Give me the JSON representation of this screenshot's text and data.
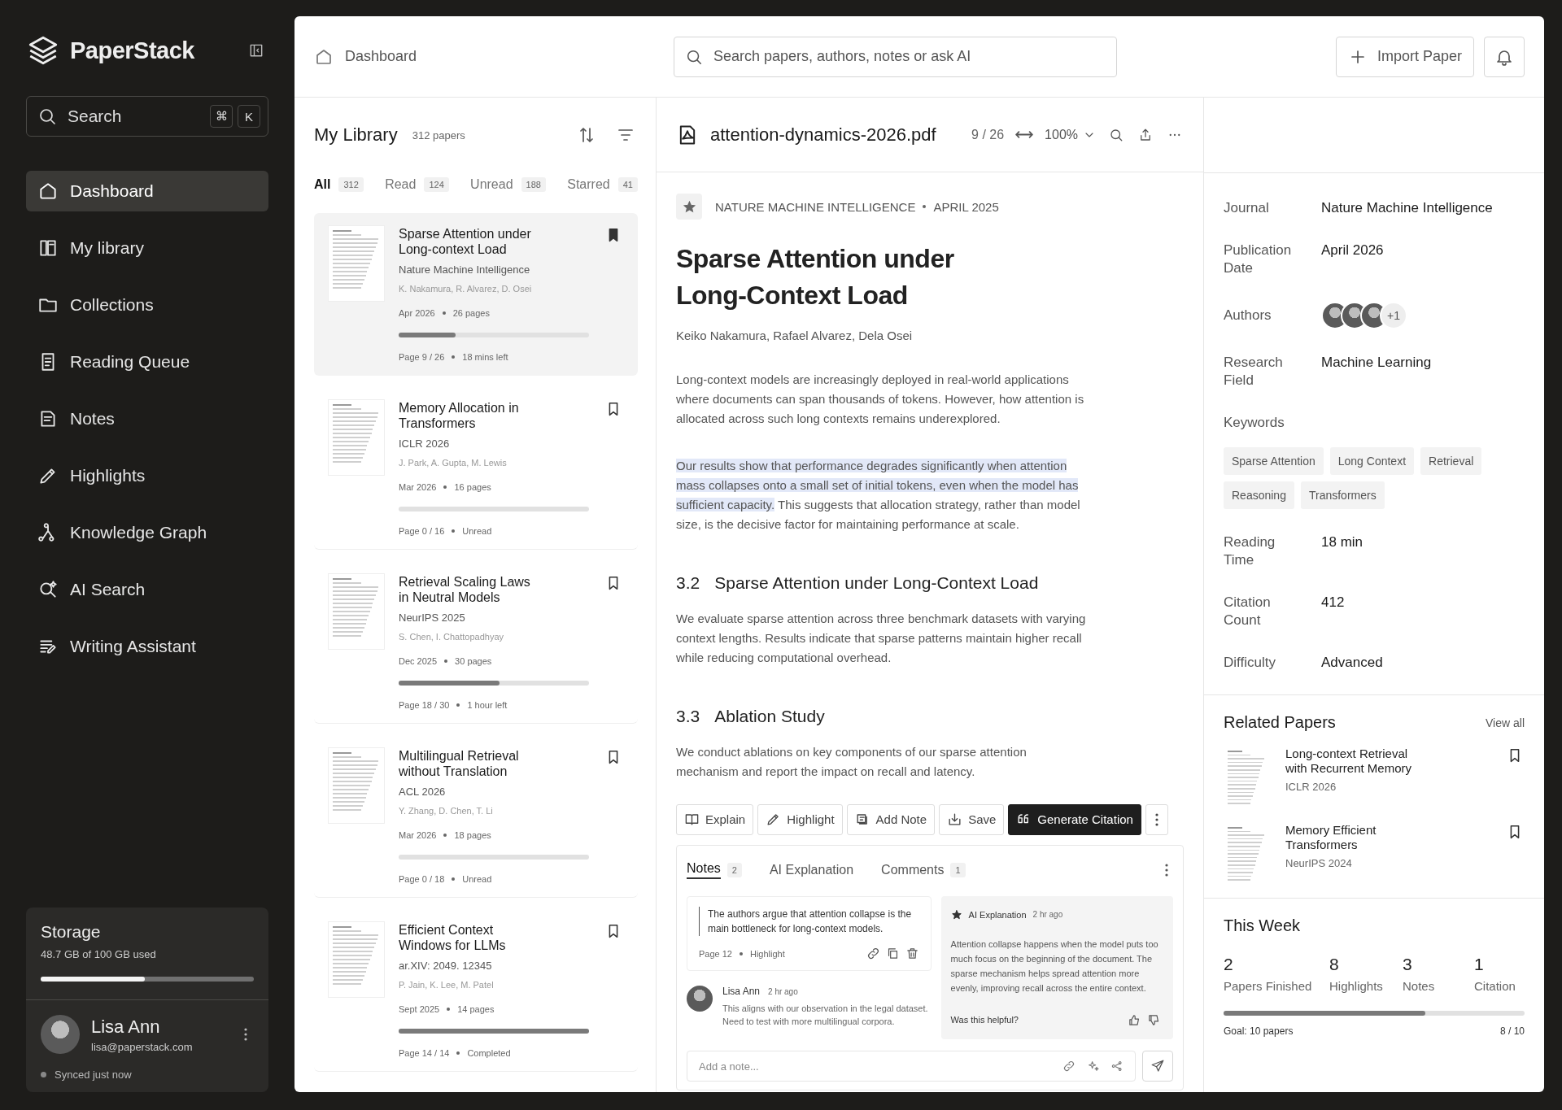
{
  "sidebar": {
    "brand": "PaperStack",
    "search": {
      "placeholder": "Search",
      "shortcut": [
        "⌘",
        "K"
      ]
    },
    "items": [
      {
        "label": "Dashboard",
        "selected": true
      },
      {
        "label": "My library",
        "selected": false
      },
      {
        "label": "Collections",
        "selected": false
      },
      {
        "label": "Reading Queue",
        "selected": false
      },
      {
        "label": "Notes",
        "selected": false
      },
      {
        "label": "Highlights",
        "selected": false
      },
      {
        "label": "Knowledge Graph",
        "selected": false
      },
      {
        "label": "AI Search",
        "selected": false
      },
      {
        "label": "Writing Assistant",
        "selected": false
      }
    ],
    "storage": {
      "title": "Storage",
      "usage": "48.7 GB of 100 GB used",
      "level": 0.487
    },
    "user": {
      "name": "Lisa Ann",
      "email": "lisa@paperstack.com",
      "sync": "Synced just now"
    }
  },
  "header": {
    "breadcrumb": "Dashboard",
    "search": {
      "placeholder": "Search papers, authors, notes or ask AI"
    },
    "import_button": "Import Paper"
  },
  "library": {
    "title": "My Library",
    "count": "312 papers",
    "tabs": [
      {
        "label": "All",
        "count": "312",
        "selected": true
      },
      {
        "label": "Read",
        "count": "124",
        "selected": false
      },
      {
        "label": "Unread",
        "count": "188",
        "selected": false
      },
      {
        "label": "Starred",
        "count": "41",
        "selected": false
      }
    ],
    "papers": [
      {
        "title": "Sparse Attention under Long-context Load",
        "venue": "Nature Machine Intelligence",
        "authors": "K. Nakamura, R. Alvarez, D. Osei",
        "date": "Apr 2026",
        "pages": "26 pages",
        "level": 0.3,
        "progress": "Page 9 / 26",
        "status": "18 mins left",
        "bookmarked": true,
        "selected": true
      },
      {
        "title": "Memory Allocation in Transformers",
        "venue": "ICLR 2026",
        "authors": "J. Park, A. Gupta, M. Lewis",
        "date": "Mar 2026",
        "pages": "16 pages",
        "level": 0,
        "progress": "Page 0 / 16",
        "status": "Unread",
        "bookmarked": false,
        "selected": false
      },
      {
        "title": "Retrieval Scaling Laws in Neutral Models",
        "venue": "NeurIPS 2025",
        "authors": "S. Chen, I. Chattopadhyay",
        "date": "Dec 2025",
        "pages": "30 pages",
        "level": 0.53,
        "progress": "Page 18 / 30",
        "status": "1 hour left",
        "bookmarked": false,
        "selected": false
      },
      {
        "title": "Multilingual Retrieval without Translation",
        "venue": "ACL 2026",
        "authors": "Y. Zhang, D. Chen, T. Li",
        "date": "Mar 2026",
        "pages": "18 pages",
        "level": 0,
        "progress": "Page 0 / 18",
        "status": "Unread",
        "bookmarked": false,
        "selected": false
      },
      {
        "title": "Efficient Context Windows for LLMs",
        "venue": "ar.XIV: 2049. 12345",
        "authors": "P. Jain, K. Lee, M. Patel",
        "date": "Sept 2025",
        "pages": "14 pages",
        "level": 1,
        "progress": "Page 14 / 14",
        "status": "Completed",
        "bookmarked": false,
        "selected": false
      }
    ]
  },
  "reader": {
    "file": "attention-dynamics-2026.pdf",
    "page": "9 / 26",
    "zoom": "100%",
    "starred": true,
    "journal": "NATURE MACHINE INTELLIGENCE",
    "date": "APRIL 2025",
    "title": "Sparse Attention under Long-Context Load",
    "authors": "Keiko Nakamura, Rafael Alvarez, Dela Osei",
    "abstract": "Long-context models are increasingly deployed in real-world applications where documents can span thousands of tokens. However, how attention is allocated across such long contexts remains underexplored.",
    "finding": {
      "highlight": "Our results show that performance degrades significantly when attention mass collapses onto a small set of initial tokens, even when the model has sufficient capacity.",
      "text": " This suggests that allocation strategy, rather than model size, is the decisive factor for maintaining performance at scale."
    },
    "sections": [
      {
        "number": "3.2",
        "heading": "Sparse Attention under Long-Context Load",
        "text": "We evaluate sparse attention across three benchmark datasets with varying context lengths. Results indicate that sparse patterns maintain higher recall while reducing computational overhead."
      },
      {
        "number": "3.3",
        "heading": "Ablation Study",
        "text": "We conduct ablations on key components of our sparse attention mechanism and report the impact on recall and latency."
      }
    ],
    "actions": [
      {
        "label": "Explain",
        "kind": "book",
        "primary": false
      },
      {
        "label": "Highlight",
        "kind": "pen",
        "primary": false
      },
      {
        "label": "Add Note",
        "kind": "note",
        "primary": false
      },
      {
        "label": "Save",
        "kind": "save",
        "primary": false
      },
      {
        "label": "Generate Citation",
        "kind": "quote",
        "primary": true
      }
    ],
    "notes_panel": {
      "tabs": [
        {
          "label": "Notes",
          "count": "2",
          "selected": true
        },
        {
          "label": "AI Explanation",
          "selected": false
        },
        {
          "label": "Comments",
          "count": "1",
          "selected": false
        }
      ],
      "note": {
        "text": "The authors argue that attention collapse is the main bottleneck for long-context models.",
        "page": "Page 12",
        "type": "Highlight"
      },
      "comment": {
        "author": "Lisa Ann",
        "time": "2 hr ago",
        "text": "This aligns with our observation in the legal dataset. Need to test with more multilingual corpora."
      },
      "ai": {
        "title": "AI Explanation",
        "time": "2 hr ago",
        "text": "Attention collapse happens when the model puts too much focus on the beginning of the document. The sparse mechanism helps spread attention more evenly, improving recall across the entire context.",
        "feedback": "Was this helpful?"
      },
      "input": {
        "placeholder": "Add a note..."
      }
    }
  },
  "details": {
    "fields": [
      {
        "label": "Journal",
        "value": "Nature Machine Intelligence"
      },
      {
        "label": "Publication Date",
        "value": "April 2026"
      }
    ],
    "authors": {
      "label": "Authors",
      "more": "+1"
    },
    "fields2": [
      {
        "label": "Research Field",
        "value": "Machine Learning"
      }
    ],
    "keywords": {
      "label": "Keywords",
      "items": [
        "Sparse Attention",
        "Long Context",
        "Retrieval",
        "Reasoning",
        "Transformers"
      ]
    },
    "fields3": [
      {
        "label": "Reading Time",
        "value": "18 min"
      },
      {
        "label": "Citation Count",
        "value": "412"
      },
      {
        "label": "Difficulty",
        "value": "Advanced"
      }
    ]
  },
  "related": {
    "title": "Related Papers",
    "view_all": "View all",
    "papers": [
      {
        "title": "Long-context Retrieval with Recurrent Memory",
        "venue": "ICLR 2026"
      },
      {
        "title": "Memory Efficient Transformers",
        "venue": "NeurIPS 2024"
      }
    ]
  },
  "week": {
    "title": "This Week",
    "stats": [
      {
        "value": "2",
        "label": "Papers Finished"
      },
      {
        "value": "8",
        "label": "Highlights"
      },
      {
        "value": "3",
        "label": "Notes"
      },
      {
        "value": "1",
        "label": "Citation"
      }
    ],
    "goal": "Goal: 10 papers",
    "level": 0.67,
    "progress": "8 / 10"
  }
}
